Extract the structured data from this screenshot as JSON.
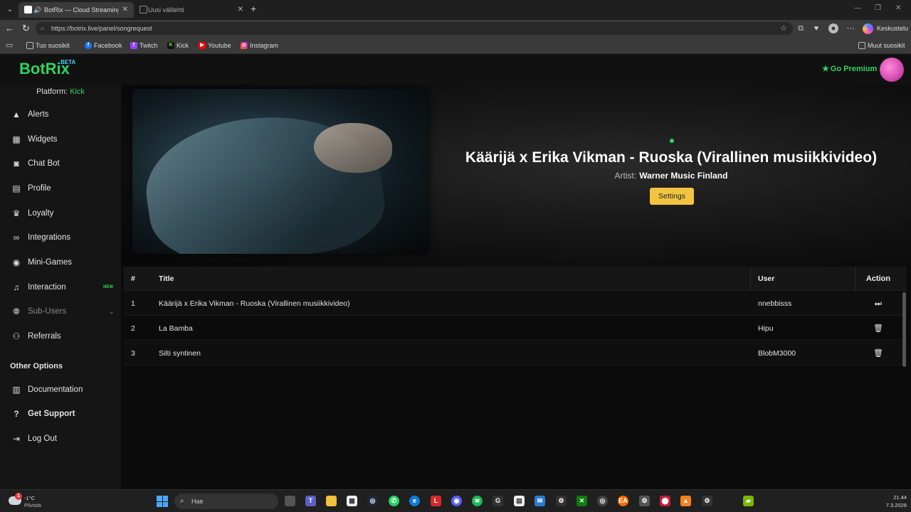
{
  "browser": {
    "tabs": [
      {
        "title": "BotRix — Cloud Streaming Bo",
        "active": true
      },
      {
        "title": "Uusi välilehti",
        "active": false
      }
    ],
    "url": "https://botrix.live/panel/songrequest",
    "profile_button": "Keskustelu",
    "bookmarks": [
      {
        "label": "Tuo suosikit",
        "icon": "import-icon"
      },
      {
        "label": "Facebook",
        "icon": "facebook-icon"
      },
      {
        "label": "Twitch",
        "icon": "twitch-icon"
      },
      {
        "label": "Kick",
        "icon": "kick-icon"
      },
      {
        "label": "Youtube",
        "icon": "youtube-icon"
      },
      {
        "label": "Instagram",
        "icon": "instagram-icon"
      }
    ],
    "other_bookmarks": "Muut suosikit"
  },
  "header": {
    "logo": "BotRix",
    "logo_badge": "BETA",
    "premium_label": "Go Premium"
  },
  "sidebar": {
    "platform_label": "Platform:",
    "platform_value": "Kick",
    "items": [
      {
        "label": "Alerts",
        "icon": "alert-triangle-icon"
      },
      {
        "label": "Widgets",
        "icon": "grid-icon"
      },
      {
        "label": "Chat Bot",
        "icon": "robot-icon"
      },
      {
        "label": "Profile",
        "icon": "id-card-icon"
      },
      {
        "label": "Loyalty",
        "icon": "trophy-icon"
      },
      {
        "label": "Integrations",
        "icon": "link-icon"
      },
      {
        "label": "Mini-Games",
        "icon": "gamepad-icon"
      },
      {
        "label": "Interaction",
        "icon": "music-note-icon",
        "badge": "NEW"
      },
      {
        "label": "Sub-Users",
        "icon": "users-icon"
      },
      {
        "label": "Referrals",
        "icon": "user-group-icon"
      }
    ],
    "other_options_title": "Other Options",
    "other_items": [
      {
        "label": "Documentation",
        "icon": "book-icon"
      },
      {
        "label": "Get Support",
        "icon": "question-circle-icon"
      },
      {
        "label": "Log Out",
        "icon": "logout-icon"
      }
    ]
  },
  "player": {
    "title": "Käärijä x Erika Vikman - Ruoska (Virallinen musiikkivideo)",
    "artist_label": "Artist:",
    "artist": "Warner Music Finland",
    "settings_label": "Settings"
  },
  "queue": {
    "columns": [
      "#",
      "Title",
      "User",
      "Action"
    ],
    "rows": [
      {
        "num": "1",
        "title": "Käärijä x Erika Vikman - Ruoska (Virallinen musiikkivideo)",
        "user": "nnebbisss",
        "action": "skip-icon"
      },
      {
        "num": "2",
        "title": "La Bamba",
        "user": "Hipu",
        "action": "trash-icon"
      },
      {
        "num": "3",
        "title": "Silti syntinen",
        "user": "BlobM3000",
        "action": "trash-icon"
      }
    ]
  },
  "taskbar": {
    "temperature": "-1°C",
    "weather": "Pilvistä",
    "search_placeholder": "Hae",
    "time": "21.44",
    "date": "7.3.2026"
  },
  "colors": {
    "accent": "#2fd35f",
    "settings_button": "#f2c440",
    "badge_beta": "#4dd0ff"
  }
}
